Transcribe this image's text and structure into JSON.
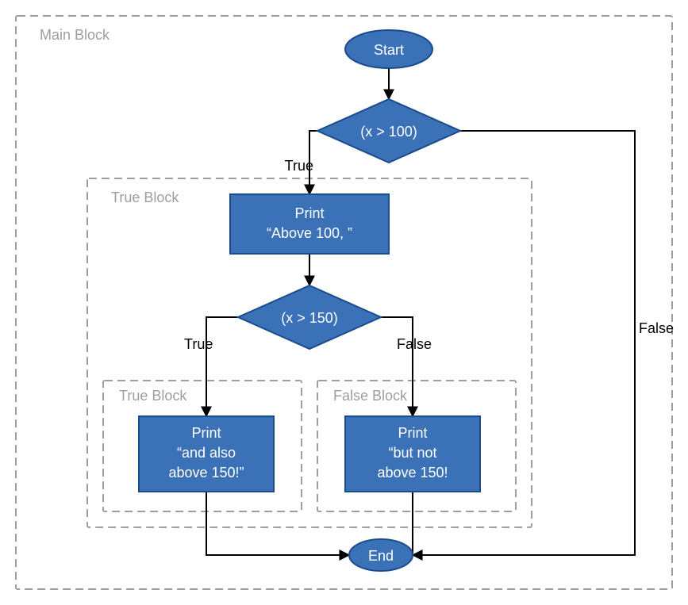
{
  "diagram": {
    "blocks": {
      "main": {
        "label": "Main Block"
      },
      "true_outer": {
        "label": "True Block"
      },
      "true_inner": {
        "label": "True Block"
      },
      "false_inner": {
        "label": "False Block"
      }
    },
    "nodes": {
      "start": {
        "label": "Start"
      },
      "cond1": {
        "label": "(x > 100)"
      },
      "print1a": {
        "line1": "Print",
        "line2": "“Above 100, ”"
      },
      "cond2": {
        "label": "(x > 150)"
      },
      "print2a": {
        "line1": "Print",
        "line2": "“and also",
        "line3": "above 150!”"
      },
      "print2b": {
        "line1": "Print",
        "line2": "“but not",
        "line3": "above 150!"
      },
      "end": {
        "label": "End"
      }
    },
    "edges": {
      "cond1_true": {
        "label": "True"
      },
      "cond1_false": {
        "label": "False"
      },
      "cond2_true": {
        "label": "True"
      },
      "cond2_false": {
        "label": "False"
      }
    }
  },
  "chart_data": {
    "type": "flowchart",
    "title": "",
    "nodes": [
      {
        "id": "start",
        "type": "terminator",
        "label": "Start"
      },
      {
        "id": "cond1",
        "type": "decision",
        "label": "(x > 100)"
      },
      {
        "id": "print1",
        "type": "process",
        "label": "Print \"Above 100, \""
      },
      {
        "id": "cond2",
        "type": "decision",
        "label": "(x > 150)"
      },
      {
        "id": "print2a",
        "type": "process",
        "label": "Print \"and also above 150!\""
      },
      {
        "id": "print2b",
        "type": "process",
        "label": "Print \"but not above 150!"
      },
      {
        "id": "end",
        "type": "terminator",
        "label": "End"
      }
    ],
    "edges": [
      {
        "from": "start",
        "to": "cond1",
        "label": ""
      },
      {
        "from": "cond1",
        "to": "print1",
        "label": "True"
      },
      {
        "from": "cond1",
        "to": "end",
        "label": "False"
      },
      {
        "from": "print1",
        "to": "cond2",
        "label": ""
      },
      {
        "from": "cond2",
        "to": "print2a",
        "label": "True"
      },
      {
        "from": "cond2",
        "to": "print2b",
        "label": "False"
      },
      {
        "from": "print2a",
        "to": "end",
        "label": ""
      },
      {
        "from": "print2b",
        "to": "end",
        "label": ""
      }
    ],
    "groups": [
      {
        "id": "main",
        "label": "Main Block",
        "contains": [
          "start",
          "cond1",
          "print1",
          "cond2",
          "print2a",
          "print2b",
          "end"
        ]
      },
      {
        "id": "true_outer",
        "label": "True Block",
        "contains": [
          "print1",
          "cond2",
          "print2a",
          "print2b"
        ]
      },
      {
        "id": "true_inner",
        "label": "True Block",
        "contains": [
          "print2a"
        ]
      },
      {
        "id": "false_inner",
        "label": "False Block",
        "contains": [
          "print2b"
        ]
      }
    ]
  }
}
